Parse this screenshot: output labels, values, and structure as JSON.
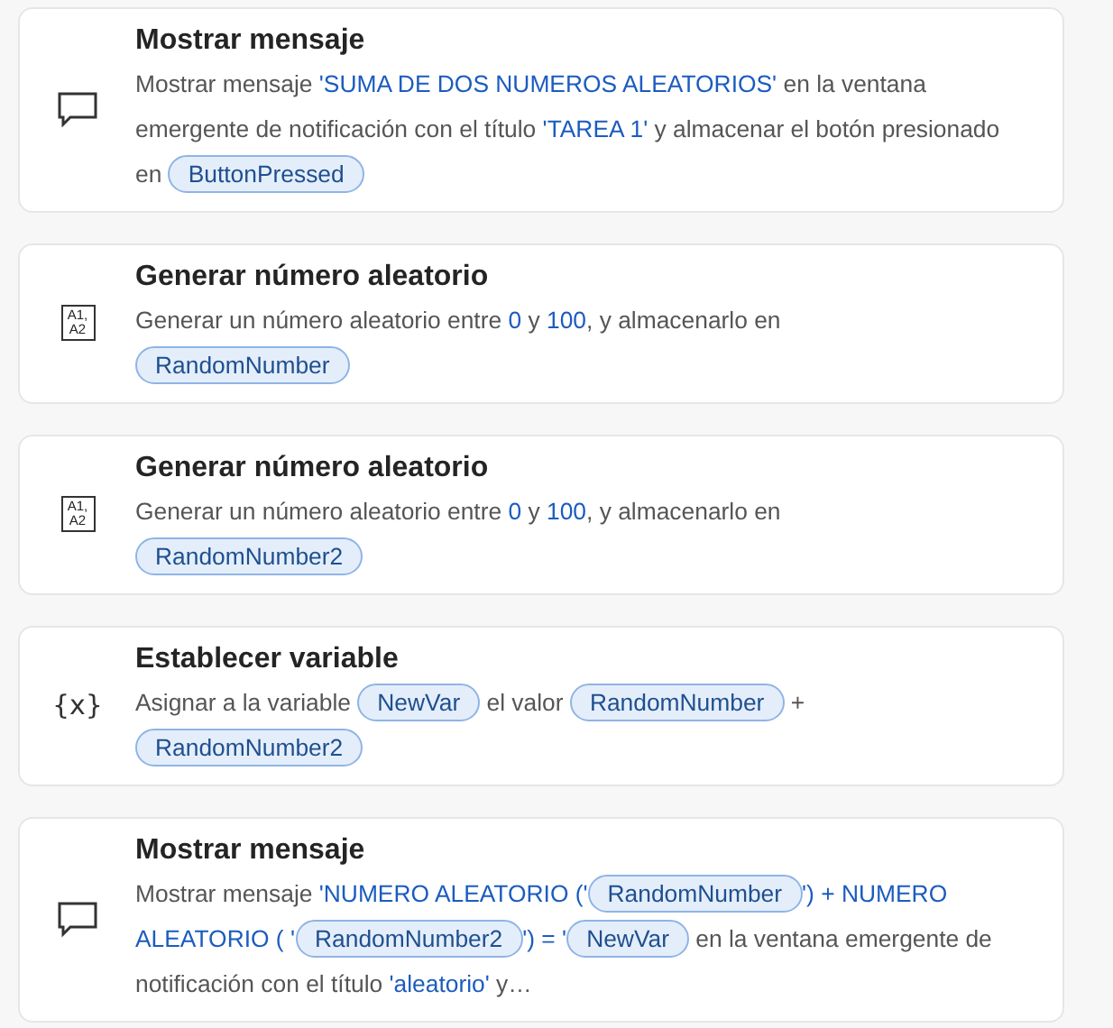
{
  "actions": [
    {
      "kind": "message",
      "title": "Mostrar mensaje",
      "description": [
        {
          "kind": "text",
          "text": "Mostrar mensaje "
        },
        {
          "kind": "value",
          "text": "'SUMA DE DOS NUMEROS ALEATORIOS'"
        },
        {
          "kind": "text",
          "text": " en la ventana emergente de notificación con el título "
        },
        {
          "kind": "value",
          "text": "'TAREA 1'"
        },
        {
          "kind": "text",
          "text": " y almacenar el botón presionado en "
        },
        {
          "kind": "var",
          "text": "ButtonPressed"
        }
      ]
    },
    {
      "kind": "random",
      "icon_text": [
        "A1,",
        "A2"
      ],
      "title": "Generar número aleatorio",
      "description": [
        {
          "kind": "text",
          "text": "Generar un número aleatorio entre "
        },
        {
          "kind": "value",
          "text": "0"
        },
        {
          "kind": "text",
          "text": " y "
        },
        {
          "kind": "value",
          "text": "100"
        },
        {
          "kind": "text",
          "text": ", y almacenarlo en "
        },
        {
          "kind": "break"
        },
        {
          "kind": "var",
          "text": "RandomNumber"
        }
      ]
    },
    {
      "kind": "random",
      "icon_text": [
        "A1,",
        "A2"
      ],
      "title": "Generar número aleatorio",
      "description": [
        {
          "kind": "text",
          "text": "Generar un número aleatorio entre "
        },
        {
          "kind": "value",
          "text": "0"
        },
        {
          "kind": "text",
          "text": " y "
        },
        {
          "kind": "value",
          "text": "100"
        },
        {
          "kind": "text",
          "text": ", y almacenarlo en "
        },
        {
          "kind": "break"
        },
        {
          "kind": "var",
          "text": "RandomNumber2"
        }
      ]
    },
    {
      "kind": "variable",
      "icon_text": [
        "{x}"
      ],
      "title": "Establecer variable",
      "description": [
        {
          "kind": "text",
          "text": "Asignar a la variable "
        },
        {
          "kind": "var",
          "text": "NewVar"
        },
        {
          "kind": "text",
          "text": " el valor "
        },
        {
          "kind": "var",
          "text": "RandomNumber"
        },
        {
          "kind": "text",
          "text": " + "
        },
        {
          "kind": "break"
        },
        {
          "kind": "var",
          "text": "RandomNumber2"
        }
      ]
    },
    {
      "kind": "message",
      "title": "Mostrar mensaje",
      "description": [
        {
          "kind": "text",
          "text": "Mostrar mensaje "
        },
        {
          "kind": "value",
          "text": "'NUMERO ALEATORIO ('"
        },
        {
          "kind": "var",
          "text": "RandomNumber"
        },
        {
          "kind": "value",
          "text": "') + NUMERO ALEATORIO ( '"
        },
        {
          "kind": "var",
          "text": "RandomNumber2"
        },
        {
          "kind": "value",
          "text": "') =  '"
        },
        {
          "kind": "var",
          "text": "NewVar"
        },
        {
          "kind": "text",
          "text": " en la ventana emergente de notificación con el título "
        },
        {
          "kind": "value",
          "text": "'aleatorio'"
        },
        {
          "kind": "text",
          "text": " y…"
        }
      ]
    }
  ]
}
